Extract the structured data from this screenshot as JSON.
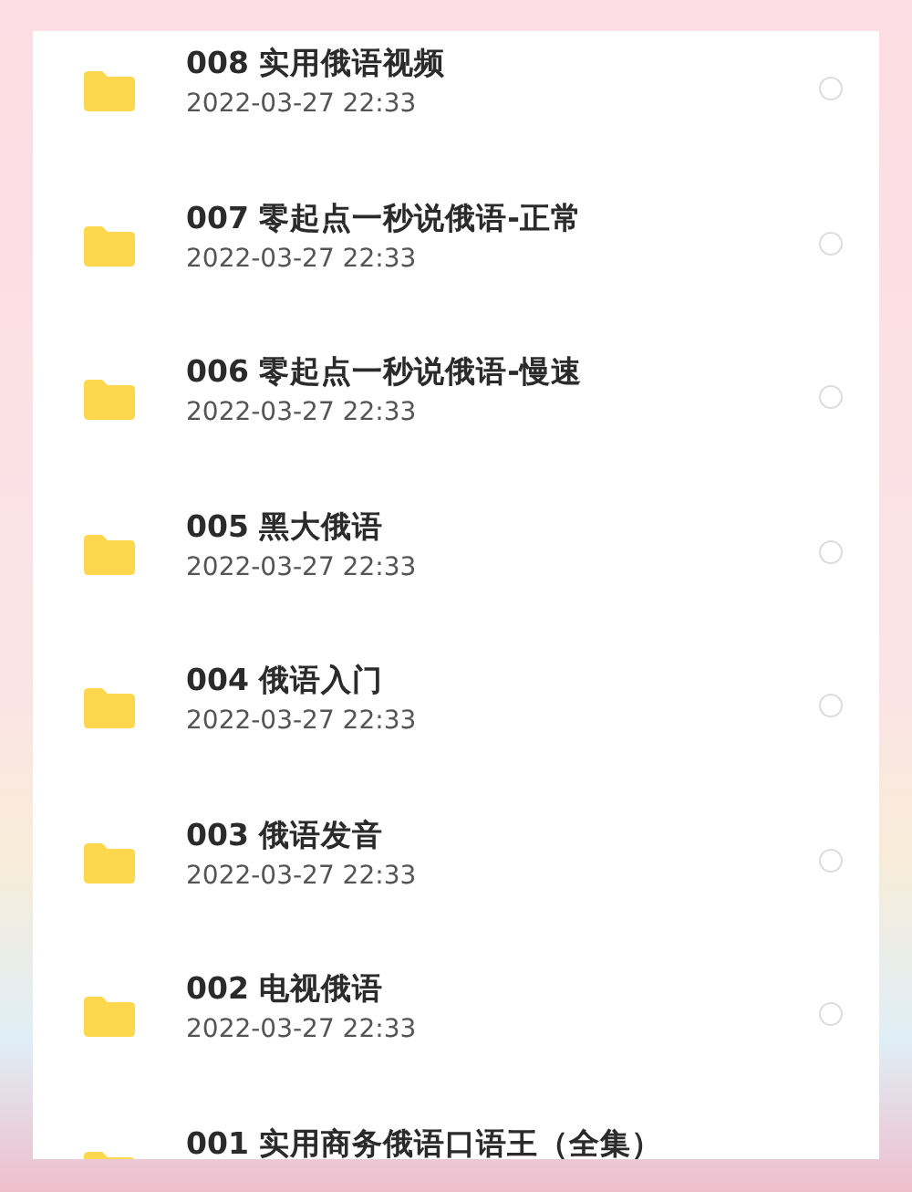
{
  "files": [
    {
      "title": "008 实用俄语视频",
      "date": "2022-03-27 22:33",
      "selected": false
    },
    {
      "title": "007 零起点一秒说俄语-正常",
      "date": "2022-03-27 22:33",
      "selected": false
    },
    {
      "title": "006 零起点一秒说俄语-慢速",
      "date": "2022-03-27 22:33",
      "selected": false
    },
    {
      "title": "005 黑大俄语",
      "date": "2022-03-27 22:33",
      "selected": false
    },
    {
      "title": "004 俄语入门",
      "date": "2022-03-27 22:33",
      "selected": false
    },
    {
      "title": "003 俄语发音",
      "date": "2022-03-27 22:33",
      "selected": false
    },
    {
      "title": "002 电视俄语",
      "date": "2022-03-27 22:33",
      "selected": false
    },
    {
      "title": "001 实用商务俄语口语王（全集）"
    }
  ]
}
